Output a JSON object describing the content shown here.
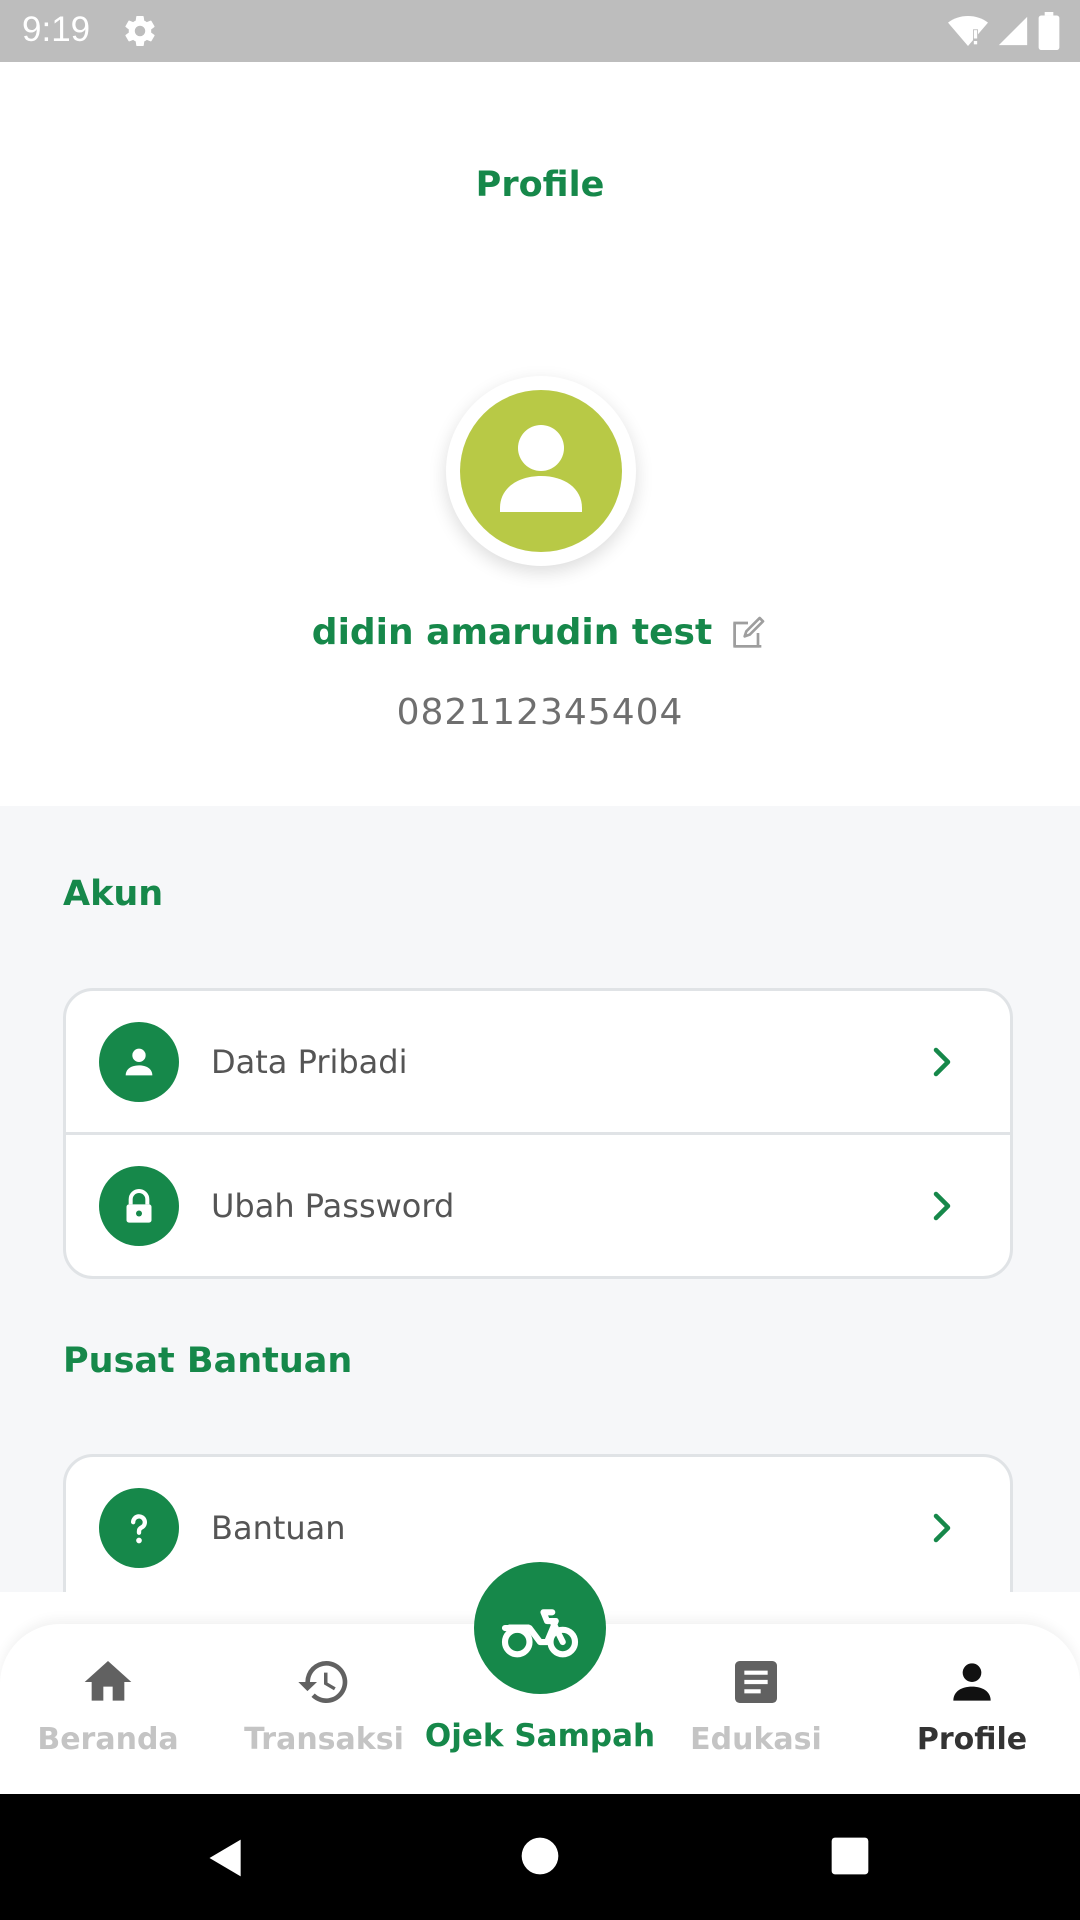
{
  "status_bar": {
    "time": "9:19"
  },
  "header": {
    "title": "Profile"
  },
  "profile": {
    "name": "didin amarudin test",
    "phone": "082112345404"
  },
  "sections": [
    {
      "title": "Akun",
      "items": [
        {
          "label": "Data Pribadi",
          "icon": "person-icon"
        },
        {
          "label": "Ubah Password",
          "icon": "lock-icon"
        }
      ]
    },
    {
      "title": "Pusat Bantuan",
      "items": [
        {
          "label": "Bantuan",
          "icon": "question-icon"
        }
      ]
    }
  ],
  "bottom_nav": {
    "items": [
      {
        "label": "Beranda",
        "icon": "home-icon"
      },
      {
        "label": "Transaksi",
        "icon": "history-icon"
      },
      {
        "label": "Ojek Sampah",
        "icon": "motorcycle-icon"
      },
      {
        "label": "Edukasi",
        "icon": "article-icon"
      },
      {
        "label": "Profile",
        "icon": "person-icon"
      }
    ],
    "active": "Profile"
  },
  "colors": {
    "brand": "#16884a",
    "avatar": "#b8c946",
    "inactive": "#c4c4c4"
  }
}
